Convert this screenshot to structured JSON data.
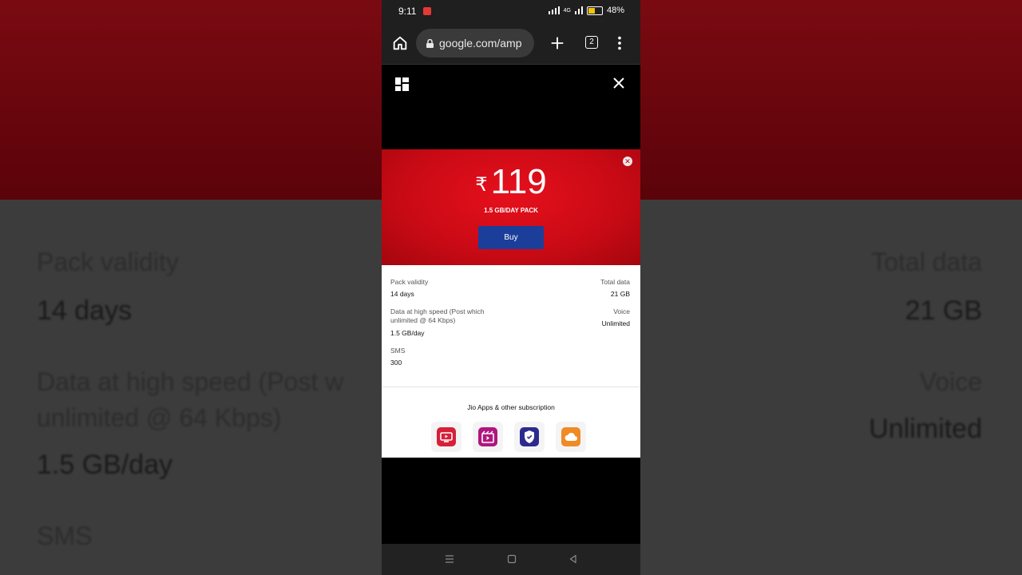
{
  "background": {
    "pack_validity_label": "Pack validity",
    "pack_validity_value": "14 days",
    "total_data_label": "Total data",
    "total_data_value": "21 GB",
    "data_speed_line1": "Data at high speed (Post w",
    "data_speed_line2": "unlimited @ 64 Kbps)",
    "data_speed_value": "1.5 GB/day",
    "voice_label": "Voice",
    "voice_value": "Unlimited",
    "sms_label": "SMS"
  },
  "status_bar": {
    "time": "9:11",
    "battery": "48%",
    "network": "4G"
  },
  "browser": {
    "url": "google.com/amp",
    "tab_count": "2"
  },
  "plan": {
    "currency": "₹",
    "price": "119",
    "pack_name": "1.5 GB/DAY PACK",
    "buy_label": "Buy",
    "pack_validity_label": "Pack validity",
    "pack_validity_value": "14 days",
    "total_data_label": "Total data",
    "total_data_value": "21 GB",
    "data_speed_label_line1": "Data at high speed (Post which",
    "data_speed_label_line2": "unlimited @ 64 Kbps)",
    "data_speed_value": "1.5 GB/day",
    "voice_label": "Voice",
    "voice_value": "Unlimited",
    "sms_label": "SMS",
    "sms_value": "300",
    "apps_title": "Jio Apps & other subscription",
    "apps": [
      {
        "icon": "jiotv-icon",
        "color": "#d81f3a"
      },
      {
        "icon": "jiocinema-icon",
        "color": "#b0167f"
      },
      {
        "icon": "jiosecurity-icon",
        "color": "#2d2a8f"
      },
      {
        "icon": "jiocloud-icon",
        "color": "#f08a24"
      }
    ]
  },
  "colors": {
    "header_red": "#d40c18",
    "buy_blue": "#1b3e9a"
  }
}
